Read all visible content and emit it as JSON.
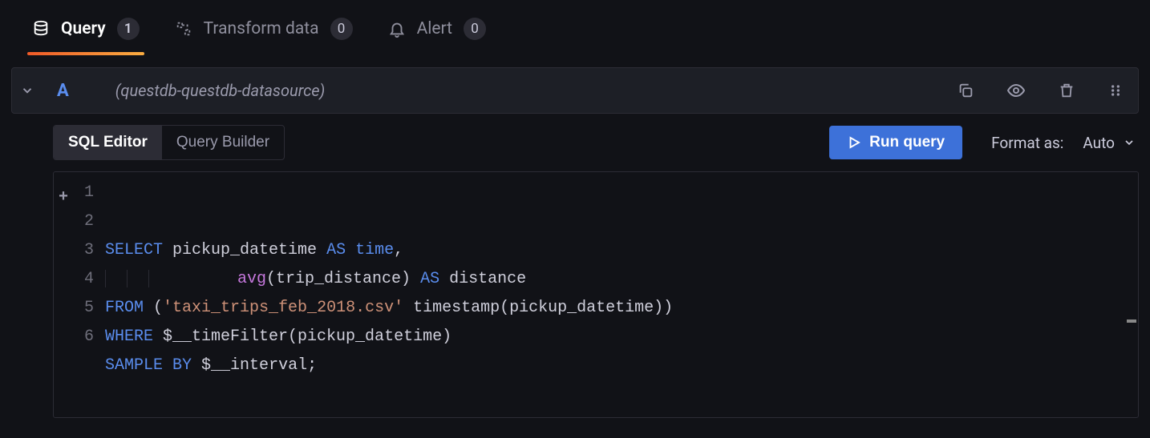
{
  "tabs": {
    "query": {
      "label": "Query",
      "count": "1"
    },
    "transform": {
      "label": "Transform data",
      "count": "0"
    },
    "alert": {
      "label": "Alert",
      "count": "0"
    }
  },
  "query_header": {
    "ref_id": "A",
    "datasource_label": "(questdb-questdb-datasource)"
  },
  "mode": {
    "sql_editor": "SQL Editor",
    "query_builder": "Query Builder"
  },
  "actions": {
    "run_query": "Run query",
    "format_label": "Format as:",
    "format_value": "Auto"
  },
  "editor": {
    "line_numbers": [
      "1",
      "2",
      "3",
      "4",
      "5",
      "6"
    ],
    "tokens": [
      [
        {
          "t": "kw",
          "v": "SELECT"
        },
        {
          "t": "sp",
          "v": " "
        },
        {
          "t": "id",
          "v": "pickup_datetime"
        },
        {
          "t": "sp",
          "v": " "
        },
        {
          "t": "kw",
          "v": "AS"
        },
        {
          "t": "sp",
          "v": " "
        },
        {
          "t": "kw",
          "v": "time"
        },
        {
          "t": "id",
          "v": ","
        }
      ],
      [
        {
          "t": "pad",
          "v": "       "
        },
        {
          "t": "fn",
          "v": "avg"
        },
        {
          "t": "id",
          "v": "(trip_distance) "
        },
        {
          "t": "kw",
          "v": "AS"
        },
        {
          "t": "id",
          "v": " distance"
        }
      ],
      [
        {
          "t": "kw",
          "v": "FROM"
        },
        {
          "t": "id",
          "v": " ("
        },
        {
          "t": "str",
          "v": "'taxi_trips_feb_2018.csv'"
        },
        {
          "t": "id",
          "v": " timestamp(pickup_datetime))"
        }
      ],
      [
        {
          "t": "kw",
          "v": "WHERE"
        },
        {
          "t": "id",
          "v": " $__timeFilter(pickup_datetime)"
        }
      ],
      [
        {
          "t": "kw",
          "v": "SAMPLE"
        },
        {
          "t": "sp",
          "v": " "
        },
        {
          "t": "kw",
          "v": "BY"
        },
        {
          "t": "id",
          "v": " $__interval;"
        }
      ],
      []
    ]
  },
  "icons": {
    "database": "database-icon",
    "transform": "transform-icon",
    "bell": "bell-icon",
    "chevron_down": "chevron-down-icon",
    "copy": "copy-icon",
    "eye": "eye-icon",
    "trash": "trash-icon",
    "grip": "grip-icon",
    "play": "play-icon"
  }
}
